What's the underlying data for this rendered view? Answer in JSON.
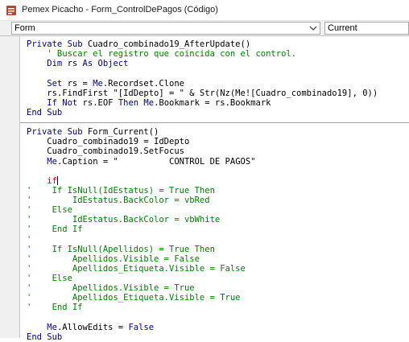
{
  "window": {
    "title": "Pemex Picacho - Form_ControlDePagos (Código)"
  },
  "toolbar": {
    "object_value": "Form",
    "procedure_value": "Current"
  },
  "code": {
    "lines": [
      {
        "seg": [
          [
            "kw",
            "Private Sub "
          ],
          [
            "tx",
            "Cuadro_combinado19_AfterUpdate()"
          ]
        ]
      },
      {
        "seg": [
          [
            "cm",
            "    ' Buscar el registro que coincida con el control."
          ]
        ]
      },
      {
        "seg": [
          [
            "kw",
            "    Dim "
          ],
          [
            "tx",
            "rs "
          ],
          [
            "kw",
            "As Object"
          ]
        ]
      },
      {
        "seg": [
          [
            "tx",
            ""
          ]
        ]
      },
      {
        "seg": [
          [
            "kw",
            "    Set "
          ],
          [
            "tx",
            "rs = "
          ],
          [
            "kw",
            "Me"
          ],
          [
            "tx",
            ".Recordset.Clone"
          ]
        ]
      },
      {
        "seg": [
          [
            "tx",
            "    rs.FindFirst \"[IdDepto] = \" & Str(Nz(Me![Cuadro_combinado19], 0))"
          ]
        ]
      },
      {
        "seg": [
          [
            "kw",
            "    If Not "
          ],
          [
            "tx",
            "rs.EOF "
          ],
          [
            "kw",
            "Then Me"
          ],
          [
            "tx",
            ".Bookmark = rs.Bookmark"
          ]
        ]
      },
      {
        "seg": [
          [
            "kw",
            "End Sub"
          ]
        ]
      },
      {
        "sep": true
      },
      {
        "seg": [
          [
            "kw",
            "Private Sub "
          ],
          [
            "tx",
            "Form_Current()"
          ]
        ]
      },
      {
        "seg": [
          [
            "tx",
            "    Cuadro_combinado19 = IdDepto"
          ]
        ]
      },
      {
        "seg": [
          [
            "tx",
            "    Cuadro_combinado19.SetFocus"
          ]
        ]
      },
      {
        "seg": [
          [
            "kw",
            "    Me"
          ],
          [
            "tx",
            ".Caption = \"          CONTROL DE PAGOS\""
          ]
        ]
      },
      {
        "seg": [
          [
            "tx",
            ""
          ]
        ]
      },
      {
        "seg": [
          [
            "err",
            "    if"
          ]
        ],
        "caret": true
      },
      {
        "seg": [
          [
            "cm",
            "'    If IsNull(IdEstatus) = True Then"
          ]
        ]
      },
      {
        "seg": [
          [
            "cm",
            "'        IdEstatus.BackColor = vbRed"
          ]
        ]
      },
      {
        "seg": [
          [
            "cm",
            "'    Else"
          ]
        ]
      },
      {
        "seg": [
          [
            "cm",
            "'        IdEstatus.BackColor = vbWhite"
          ]
        ]
      },
      {
        "seg": [
          [
            "cm",
            "'    End If"
          ]
        ]
      },
      {
        "seg": [
          [
            "cm",
            "'"
          ]
        ]
      },
      {
        "seg": [
          [
            "cm",
            "'    If IsNull(Apellidos) = True Then"
          ]
        ]
      },
      {
        "seg": [
          [
            "cm",
            "'        Apellidos.Visible = False"
          ]
        ]
      },
      {
        "seg": [
          [
            "cm",
            "'        Apellidos_Etiqueta.Visible = False"
          ]
        ]
      },
      {
        "seg": [
          [
            "cm",
            "'    Else"
          ]
        ]
      },
      {
        "seg": [
          [
            "cm",
            "'        Apellidos.Visible = True"
          ]
        ]
      },
      {
        "seg": [
          [
            "cm",
            "'        Apellidos_Etiqueta.Visible = True"
          ]
        ]
      },
      {
        "seg": [
          [
            "cm",
            "'    End If"
          ]
        ]
      },
      {
        "seg": [
          [
            "tx",
            ""
          ]
        ]
      },
      {
        "seg": [
          [
            "kw",
            "    Me"
          ],
          [
            "tx",
            ".AllowEdits = "
          ],
          [
            "kw",
            "False"
          ]
        ]
      },
      {
        "seg": [
          [
            "kw",
            "End Sub"
          ]
        ]
      }
    ]
  },
  "colors": {
    "keyword": "#00008b",
    "comment": "#008000",
    "text": "#000000",
    "error": "#d20000"
  }
}
